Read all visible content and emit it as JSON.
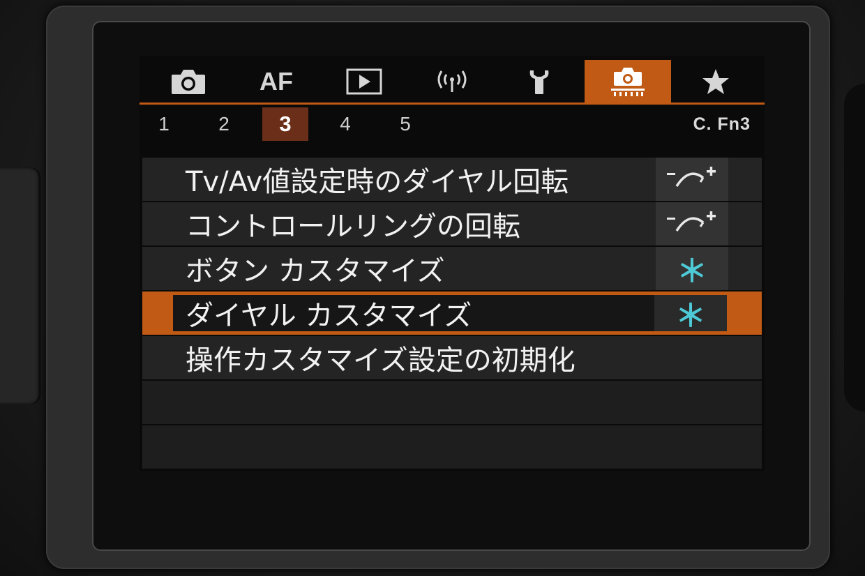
{
  "tabs": [
    {
      "icon": "camera-icon",
      "label": ""
    },
    {
      "icon": "af-text",
      "label": "AF"
    },
    {
      "icon": "playback-icon",
      "label": ""
    },
    {
      "icon": "wireless-icon",
      "label": ""
    },
    {
      "icon": "wrench-icon",
      "label": ""
    },
    {
      "icon": "custom-functions-icon",
      "label": "",
      "active": true
    },
    {
      "icon": "star-icon",
      "label": ""
    }
  ],
  "subtabs": {
    "items": [
      "1",
      "2",
      "3",
      "4",
      "5"
    ],
    "active_index": 2,
    "name": "C. Fn3"
  },
  "menu": {
    "items": [
      {
        "label": "Tv/Av値設定時のダイヤル回転",
        "value_icon": "dial-direction-icon"
      },
      {
        "label": "コントロールリングの回転",
        "value_icon": "dial-direction-icon"
      },
      {
        "label": "ボタン カスタマイズ",
        "value": "＊"
      },
      {
        "label": "ダイヤル カスタマイズ",
        "value": "＊",
        "selected": true
      },
      {
        "label": "操作カスタマイズ設定の初期化"
      }
    ]
  },
  "colors": {
    "accent": "#c05a14",
    "subtab_active": "#6b2e18",
    "asterisk": "#4ec9d6",
    "row_bg": "#242424"
  }
}
